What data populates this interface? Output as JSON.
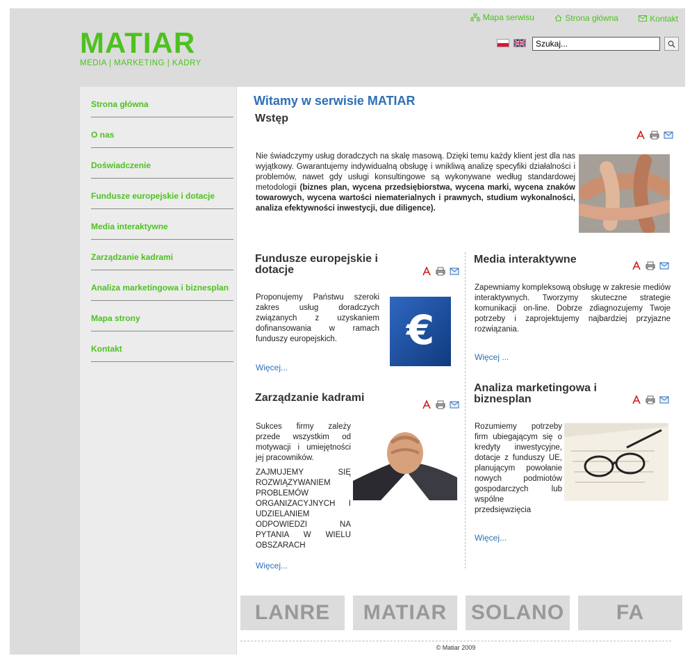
{
  "header": {
    "logo": "MATIAR",
    "logo_sub": "MEDIA  |  MARKETING  |  KADRY",
    "links": {
      "sitemap": "Mapa serwisu",
      "home": "Strona główna",
      "contact": "Kontakt"
    },
    "search": {
      "placeholder": "Szukaj...",
      "value": "Szukaj..."
    }
  },
  "sidebar": {
    "items": [
      {
        "label": "Strona główna"
      },
      {
        "label": "O nas"
      },
      {
        "label": "Doświadczenie"
      },
      {
        "label": "Fundusze europejskie i dotacje"
      },
      {
        "label": "Media interaktywne"
      },
      {
        "label": "Zarządzanie kadrami"
      },
      {
        "label": "Analiza marketingowa i biznesplan"
      },
      {
        "label": "Mapa strony"
      },
      {
        "label": "Kontakt"
      }
    ]
  },
  "main": {
    "welcome": "Witamy w serwisie MATIAR",
    "intro": {
      "title": "Wstęp",
      "text_plain": "Nie świadczymy usług doradczych na skalę masową. Dzięki temu każdy klient jest dla nas wyjątkowy. Gwarantujemy indywidualną obsługę i wnikliwą analizę specyfiki działalności i problemów, nawet gdy usługi konsultingowe są wykonywane według standardowej metodologii ",
      "text_bold": "(biznes plan, wycena przedsiębiorstwa, wycena marki, wycena znaków towarowych, wycena wartości niematerialnych i prawnych, studium wykonalności, analiza efektywności inwestycji, due diligence)."
    },
    "fundusze": {
      "title": "Fundusze europejskie i dotacje",
      "text": "Proponujemy Państwu szeroki zakres usług doradczych związanych z uzyskaniem dofinansowania w ramach funduszy europejskich.",
      "more": "Więcej..."
    },
    "media": {
      "title": "Media interaktywne",
      "text": "Zapewniamy kompleksową obsługę w zakresie mediów interaktywnych. Tworzymy skuteczne strategie komunikacji on-line. Dobrze zdiagnozujemy Twoje potrzeby i zaprojektujemy najbardziej przyjazne rozwiązania.",
      "more": "Więcej ..."
    },
    "kadry": {
      "title": "Zarządzanie kadrami",
      "text1": "Sukces firmy zależy przede wszystkim od motywacji i umiejętności jej pracowników.",
      "text2": "ZAJMUJEMY SIĘ ROZWIĄZYWANIEM PROBLEMÓW ORGANIZACYJNYCH I UDZIELANIEM ODPOWIEDZI NA PYTANIA W WIELU OBSZARACH",
      "more": "Więcej..."
    },
    "analiza": {
      "title": "Analiza marketingowa i biznesplan",
      "text": "Rozumiemy potrzeby firm ubiegającym się o kredyty inwestycyjne, dotacje z funduszy UE, planującym powołanie nowych podmiotów gospodarczych lub wspólne przedsięwzięcia",
      "more": "Więcej..."
    },
    "euro_symbol": "€",
    "partners": [
      "LANRE",
      "MATIAR",
      "SOLANO",
      "FA"
    ],
    "copyright": "© Matiar 2009"
  },
  "colors": {
    "brand_green": "#4dc21f",
    "link_blue": "#2e6fb5",
    "header_gray": "#dcdcdc"
  },
  "icons": [
    "sitemap-icon",
    "home-icon",
    "mail-icon",
    "search-icon",
    "pdf-icon",
    "print-icon",
    "email-icon"
  ]
}
